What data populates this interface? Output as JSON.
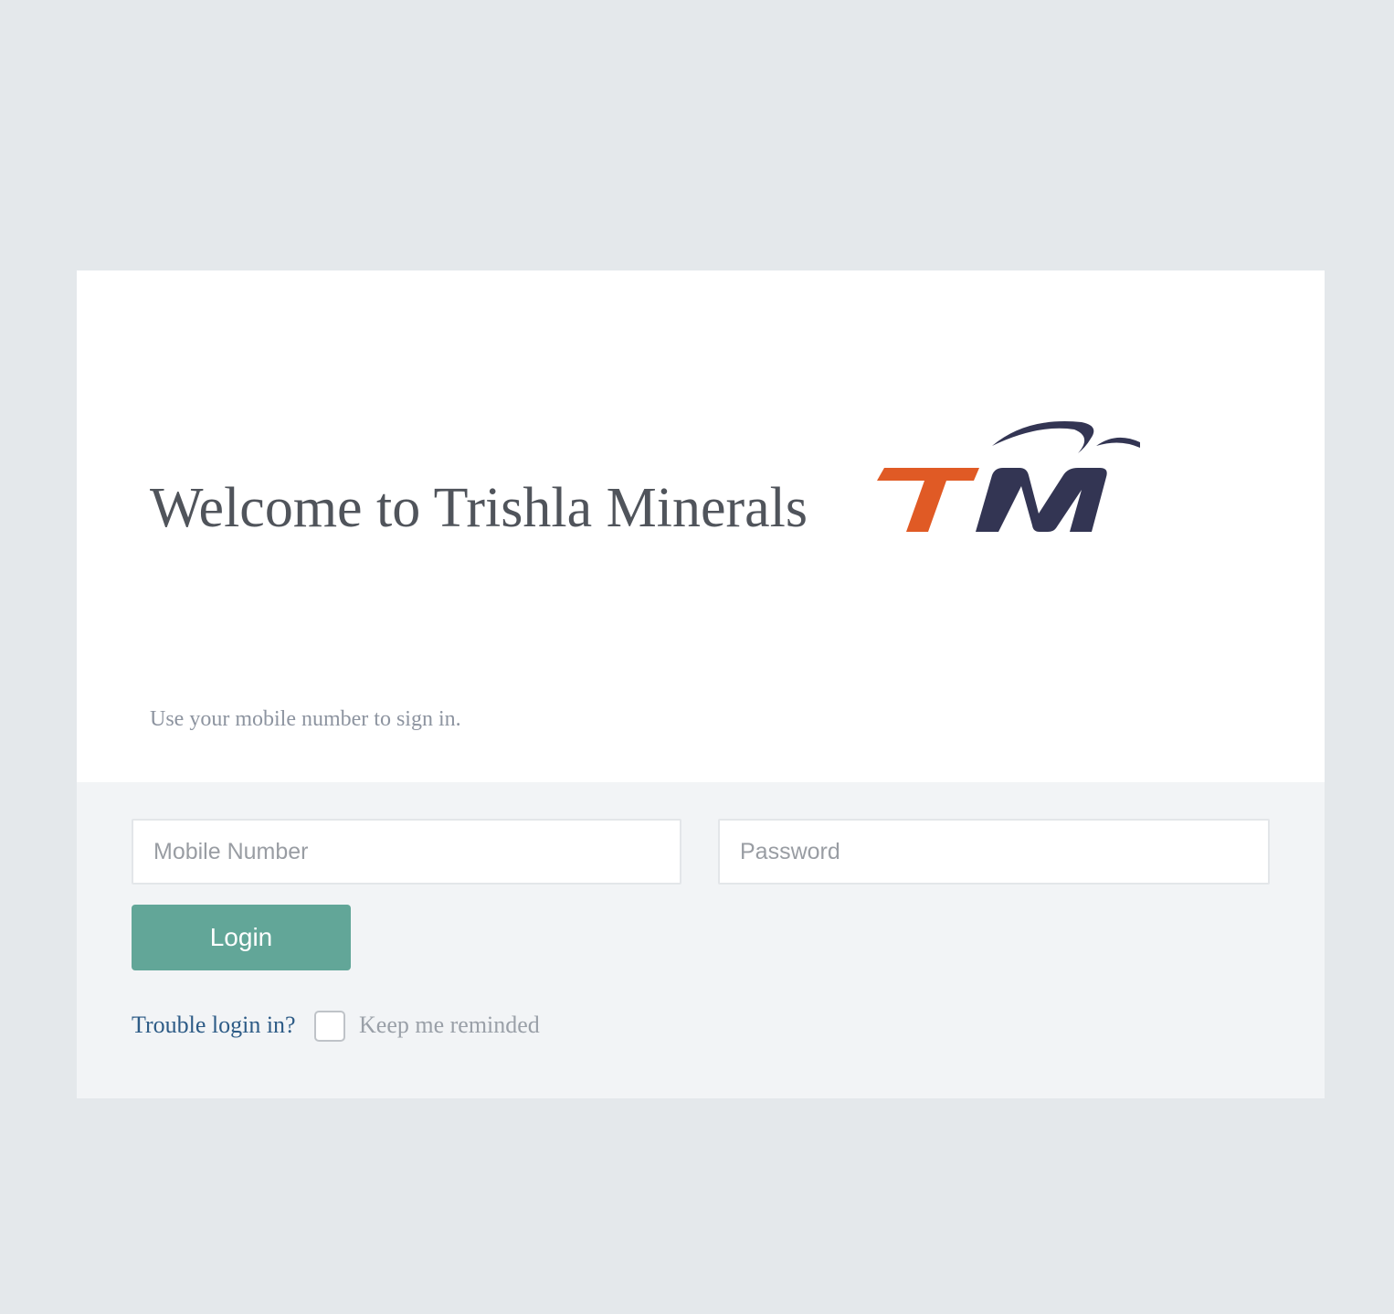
{
  "header": {
    "title": "Welcome to Trishla Minerals",
    "subtitle": "Use your mobile number to sign in.",
    "logo_text": "TM"
  },
  "form": {
    "mobile_placeholder": "Mobile Number",
    "mobile_value": "",
    "password_placeholder": "Password",
    "password_value": "",
    "login_label": "Login",
    "trouble_link_label": "Trouble login in?",
    "keep_me_label": "Keep me reminded",
    "keep_me_checked": false
  },
  "colors": {
    "page_background": "#e4e8eb",
    "form_background": "#f2f4f6",
    "login_button": "#62a698",
    "link": "#2d5b86",
    "logo_orange": "#e05a25",
    "logo_navy": "#333553"
  }
}
